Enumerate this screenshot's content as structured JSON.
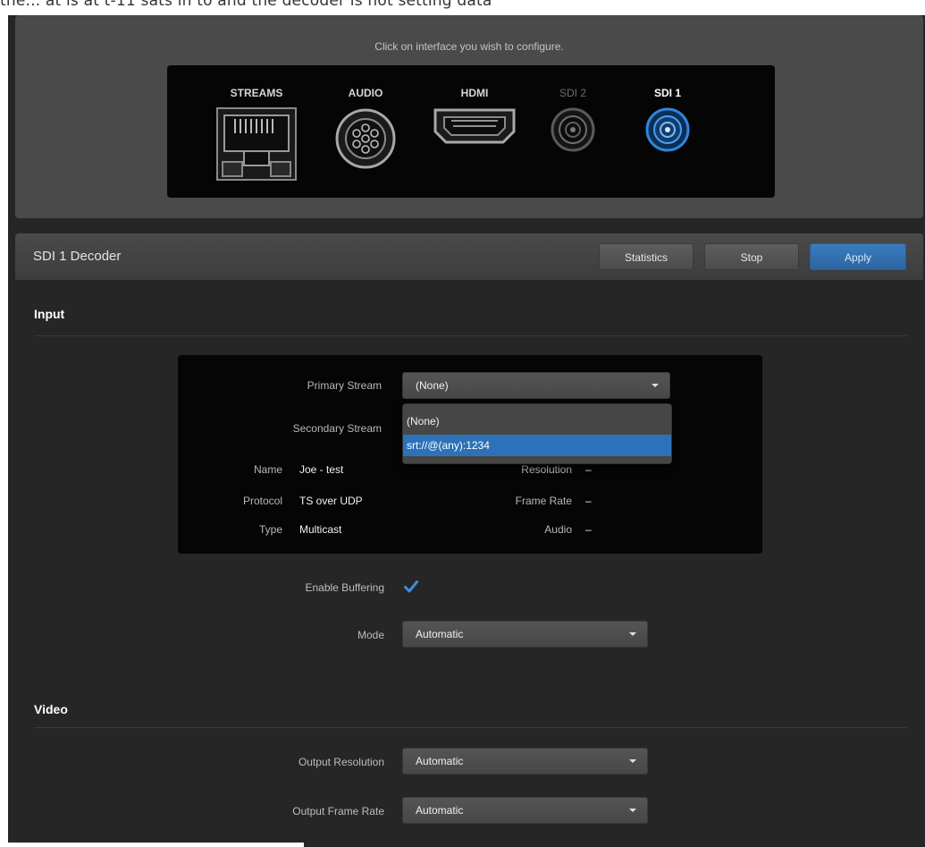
{
  "top_fragment": "the... at is at t-11 sats in to and the decoder is not setting data",
  "selector": {
    "hint": "Click on interface you wish to configure.",
    "ports": [
      {
        "label": "STREAMS",
        "icon": "ethernet-port-icon"
      },
      {
        "label": "AUDIO",
        "icon": "audio-connector-icon"
      },
      {
        "label": "HDMI",
        "icon": "hdmi-port-icon"
      },
      {
        "label": "SDI 2",
        "icon": "bnc-connector-icon"
      },
      {
        "label": "SDI 1",
        "icon": "bnc-connector-icon",
        "selected": true
      }
    ],
    "accent": "#2d72b8"
  },
  "decoder": {
    "title": "SDI 1 Decoder",
    "statistics_label": "Statistics",
    "stop_label": "Stop",
    "apply_label": "Apply"
  },
  "input": {
    "title": "Input",
    "primary_label": "Primary Stream",
    "primary_value": "(None)",
    "secondary_label": "Secondary Stream",
    "dropdown_options": [
      "(None)",
      "srt://@(any):1234"
    ],
    "dropdown_highlighted": "srt://@(any):1234",
    "info": {
      "name_label": "Name",
      "name_value": "Joe - test",
      "protocol_label": "Protocol",
      "protocol_value": "TS over UDP",
      "type_label": "Type",
      "type_value": "Multicast",
      "resolution_label": "Resolution",
      "resolution_value": "–",
      "framerate_label": "Frame Rate",
      "framerate_value": "–",
      "audio_label": "Audio",
      "audio_value": "–"
    },
    "buffering_label": "Enable Buffering",
    "buffering_checked": true,
    "mode_label": "Mode",
    "mode_value": "Automatic"
  },
  "video": {
    "title": "Video",
    "output_resolution_label": "Output Resolution",
    "output_resolution_value": "Automatic",
    "output_framerate_label": "Output Frame Rate",
    "output_framerate_value": "Automatic"
  }
}
